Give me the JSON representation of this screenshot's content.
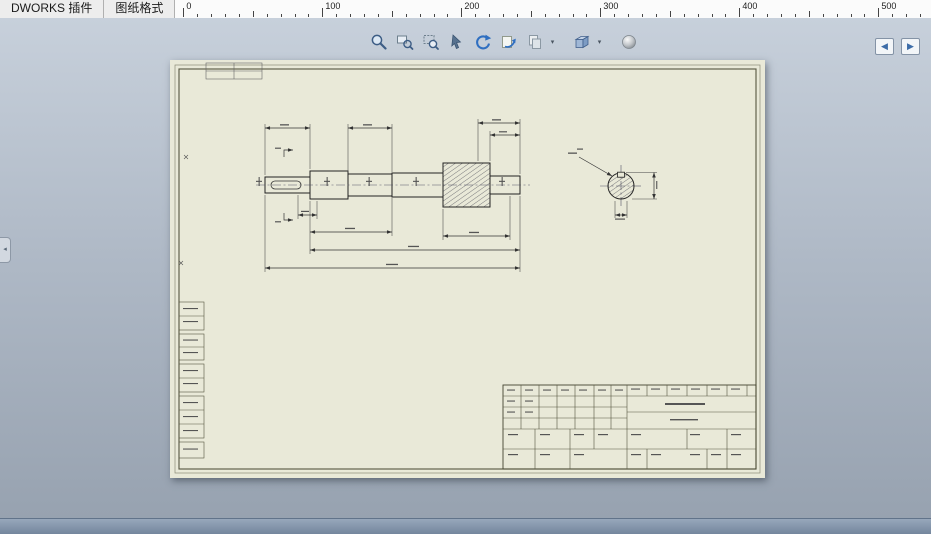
{
  "tabs": [
    {
      "label": "DWORKS 插件"
    },
    {
      "label": "图纸格式"
    }
  ],
  "ruler": {
    "unit_labels": [
      "0",
      "100",
      "200",
      "300",
      "400",
      "500"
    ]
  },
  "toolbar": {
    "icons": [
      {
        "name": "zoom-to-fit-icon"
      },
      {
        "name": "zoom-to-area-icon"
      },
      {
        "name": "zoom-window-icon"
      },
      {
        "name": "pan-arrow-icon"
      },
      {
        "name": "rotate-view-icon"
      },
      {
        "name": "view-3d-drawing-icon"
      },
      {
        "name": "copy-appearance-icon"
      },
      {
        "name": "view-orientation-icon"
      },
      {
        "name": "display-style-icon"
      }
    ],
    "dropdown_glyph": "▾"
  },
  "nav": {
    "prev_glyph": "◀",
    "next_glyph": "▶"
  },
  "panel": {
    "handle_glyph": "◂"
  },
  "colors": {
    "sheet": "#e9e9d8",
    "canvas_top": "#c7d0db",
    "canvas_bottom": "#97a2b0",
    "accent_blue": "#2f6fc1"
  }
}
